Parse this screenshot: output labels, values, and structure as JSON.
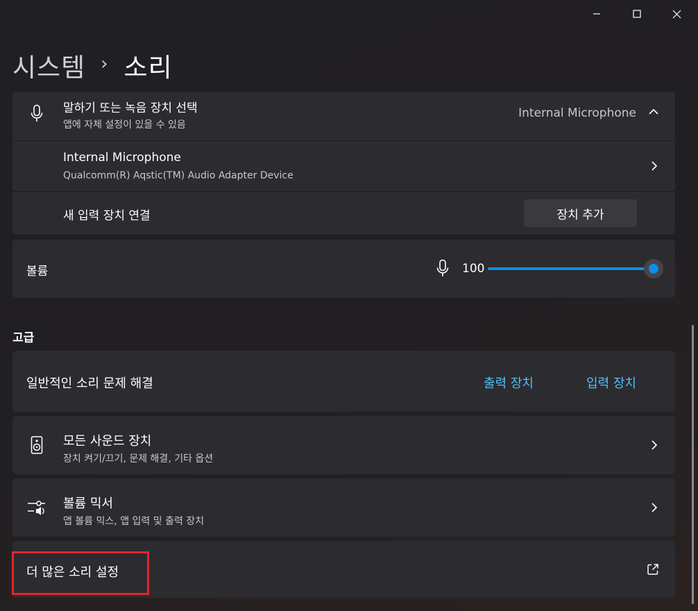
{
  "window": {
    "minimize_icon": "minimize-icon",
    "maximize_icon": "maximize-icon",
    "close_icon": "close-icon"
  },
  "breadcrumb": {
    "parent": "시스템",
    "separator": "›",
    "current": "소리"
  },
  "input_section": {
    "header": {
      "title": "말하기 또는 녹음 장치 선택",
      "subtitle": "앱에 자체 설정이 있을 수 있음",
      "selected": "Internal Microphone",
      "icon": "microphone-icon"
    },
    "device": {
      "name": "Internal Microphone",
      "description": "Qualcomm(R) Aqstic(TM) Audio Adapter Device"
    },
    "add_device": {
      "label": "새 입력 장치 연결",
      "button": "장치 추가"
    }
  },
  "volume": {
    "label": "볼륨",
    "value": "100",
    "level": 1.0,
    "icon": "microphone-icon"
  },
  "advanced": {
    "heading": "고급",
    "troubleshoot": {
      "label": "일반적인 소리 문제 해결",
      "output_link": "출력 장치",
      "input_link": "입력 장치"
    },
    "all_devices": {
      "title": "모든 사운드 장치",
      "subtitle": "장치 켜기/끄기, 문제 해결, 기타 옵션",
      "icon": "speaker-icon"
    },
    "mixer": {
      "title": "볼륨 믹서",
      "subtitle": "앱 볼륨 믹스, 앱 입력 및 출력 장치",
      "icon": "volume-mixer-icon"
    },
    "more_settings": {
      "label": "더 많은 소리 설정",
      "icon": "external-link-icon"
    }
  },
  "colors": {
    "accent": "#4cc2ff",
    "slider": "#0c8ee8",
    "highlight": "#e3262c",
    "card": "#2c2b30"
  }
}
